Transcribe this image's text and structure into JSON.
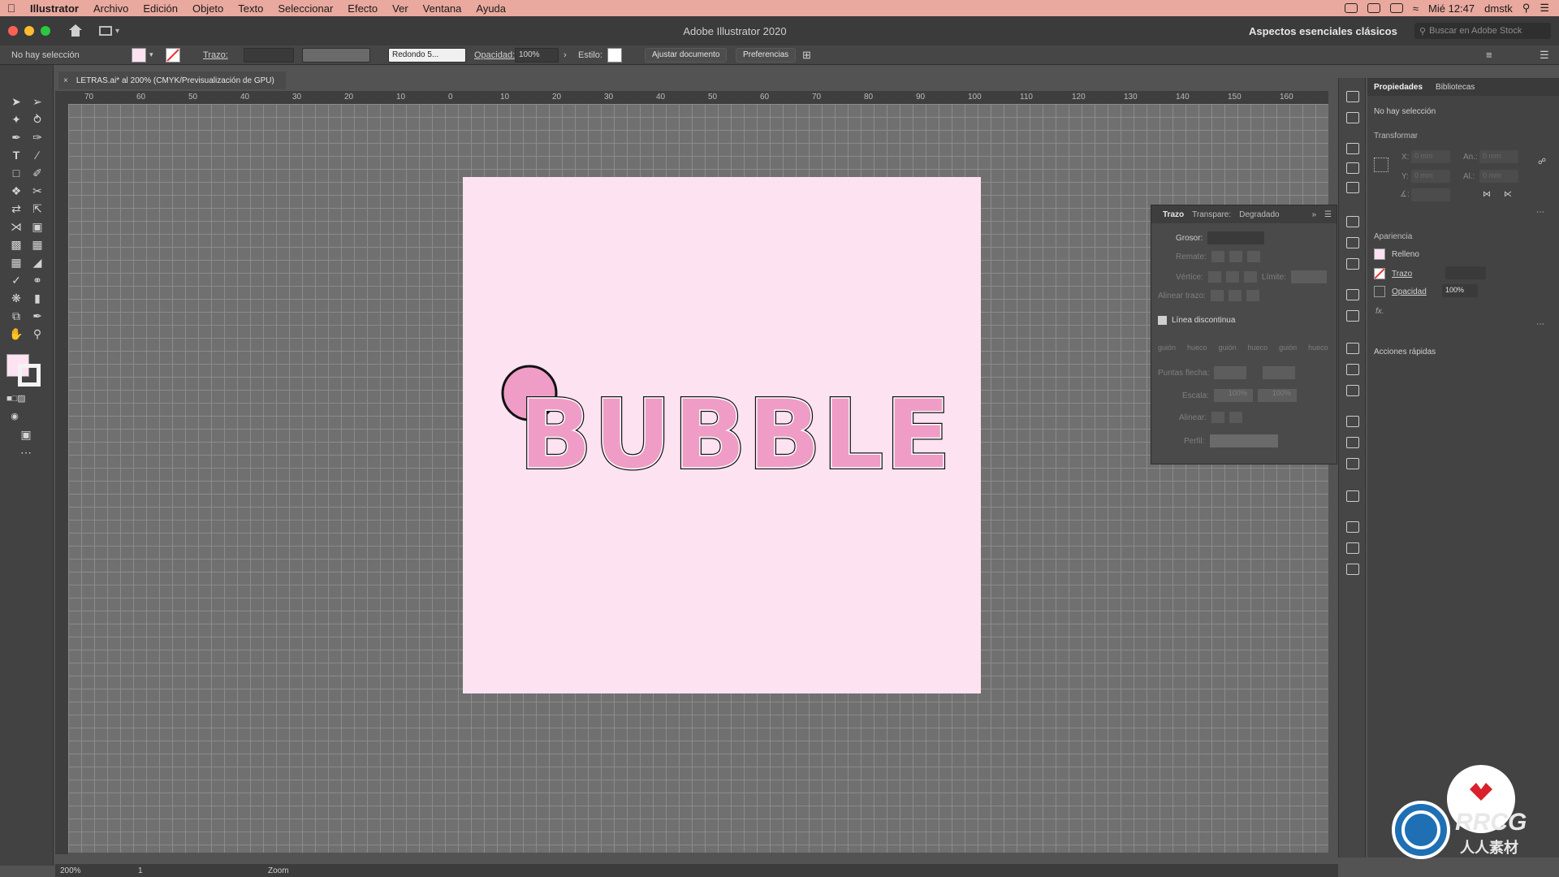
{
  "menubar": {
    "app": "Illustrator",
    "items": [
      "Archivo",
      "Edición",
      "Objeto",
      "Texto",
      "Seleccionar",
      "Efecto",
      "Ver",
      "Ventana",
      "Ayuda"
    ],
    "clock": "Mié 12:47",
    "user": "dmstk"
  },
  "titlebar": {
    "title": "Adobe Illustrator 2020",
    "workspace": "Aspectos esenciales clásicos",
    "stock_placeholder": "Buscar en Adobe Stock"
  },
  "control": {
    "selection": "No hay selección",
    "stroke_label": "Trazo:",
    "brush": "Redondo 5...",
    "opacity_label": "Opacidad:",
    "opacity_value": "100%",
    "style_label": "Estilo:",
    "fit_button": "Ajustar documento",
    "prefs_button": "Preferencias"
  },
  "document": {
    "tab_title": "LETRAS.ai* al 200% (CMYK/Previsualización de GPU)"
  },
  "ruler": {
    "labels": [
      "70",
      "60",
      "50",
      "40",
      "30",
      "20",
      "10",
      "0",
      "10",
      "20",
      "30",
      "40",
      "50",
      "60",
      "70",
      "80",
      "90",
      "100",
      "110",
      "120",
      "130",
      "140",
      "150",
      "160"
    ]
  },
  "artwork": {
    "text": "BUBBLE",
    "fill": "#ef9dc6",
    "outline": "#111111",
    "artboard_color": "#fde2f2"
  },
  "stroke_panel": {
    "tabs": [
      "Trazo",
      "Transpare:",
      "Degradado"
    ],
    "weight_label": "Grosor:",
    "cap_label": "Remate:",
    "corner_label": "Vértice:",
    "limit_label": "Límite:",
    "align_label": "Alinear trazo:",
    "dashed_label": "Línea discontinua",
    "dash_cells": [
      "guión",
      "hueco",
      "guión",
      "hueco",
      "guión",
      "hueco"
    ],
    "arrowheads_label": "Puntas flecha:",
    "scale_label": "Escala:",
    "scale_value": "100%",
    "align_arrows_label": "Alinear:",
    "profile_label": "Perfil:"
  },
  "properties": {
    "tabs": [
      "Propiedades",
      "Bibliotecas"
    ],
    "no_selection": "No hay selección",
    "transform": "Transformar",
    "x_label": "X:",
    "y_label": "Y:",
    "w_label": "An.:",
    "h_label": "Al.:",
    "angle_label": "∡:",
    "placeholder_value": "0 mm",
    "appearance": "Apariencia",
    "fill": "Relleno",
    "stroke": "Trazo",
    "opacity": "Opacidad",
    "opacity_value": "100%",
    "fx": "fx.",
    "quick_actions": "Acciones rápidas"
  },
  "status": {
    "zoom": "200%",
    "page": "1",
    "tool": "Zoom"
  },
  "logo": {
    "text": "RRCG",
    "subtext": "人人素材"
  }
}
